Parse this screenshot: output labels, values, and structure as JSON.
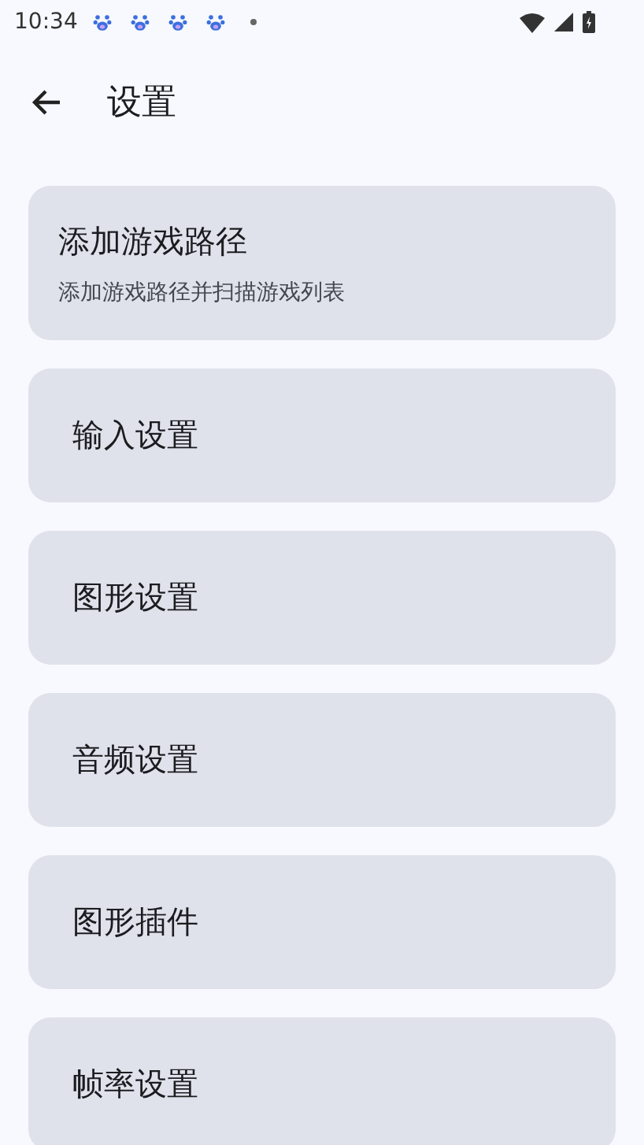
{
  "status_bar": {
    "time": "10:34",
    "notification_icons": [
      {
        "kind": "paw"
      },
      {
        "kind": "paw"
      },
      {
        "kind": "paw"
      },
      {
        "kind": "paw"
      },
      {
        "kind": "dot"
      }
    ]
  },
  "app_bar": {
    "title": "设置"
  },
  "items": [
    {
      "kind": "two-line",
      "title": "添加游戏路径",
      "subtitle": "添加游戏路径并扫描游戏列表"
    },
    {
      "kind": "single",
      "title": "输入设置"
    },
    {
      "kind": "single",
      "title": "图形设置"
    },
    {
      "kind": "single",
      "title": "音频设置"
    },
    {
      "kind": "single",
      "title": "图形插件"
    },
    {
      "kind": "single",
      "title": "帧率设置"
    }
  ]
}
